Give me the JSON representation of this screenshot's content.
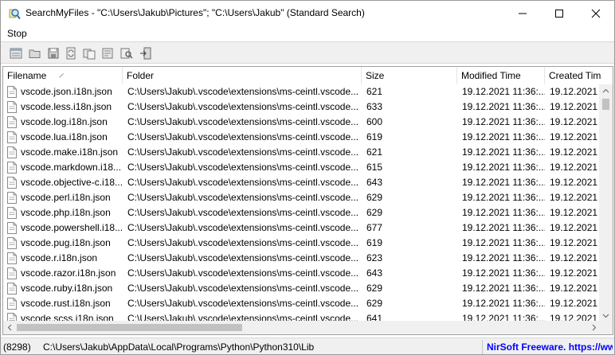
{
  "window": {
    "title": "SearchMyFiles - \"C:\\Users\\Jakub\\Pictures\"; \"C:\\Users\\Jakub\"  (Standard Search)"
  },
  "menu": {
    "stop_label": "Stop"
  },
  "toolbar": {
    "icons": [
      "new-search-icon",
      "open-icon",
      "save-icon",
      "refresh-icon",
      "copy-icon",
      "properties-icon",
      "find-icon",
      "exit-icon"
    ]
  },
  "columns": [
    {
      "label": "Filename"
    },
    {
      "label": "Folder"
    },
    {
      "label": "Size"
    },
    {
      "label": "Modified Time"
    },
    {
      "label": "Created Tim"
    }
  ],
  "rows": [
    [
      "vscode.json.i18n.json",
      "C:\\Users\\Jakub\\.vscode\\extensions\\ms-ceintl.vscode...",
      "621",
      "19.12.2021 11:36:...",
      "19.12.2021 1"
    ],
    [
      "vscode.less.i18n.json",
      "C:\\Users\\Jakub\\.vscode\\extensions\\ms-ceintl.vscode...",
      "633",
      "19.12.2021 11:36:...",
      "19.12.2021 1"
    ],
    [
      "vscode.log.i18n.json",
      "C:\\Users\\Jakub\\.vscode\\extensions\\ms-ceintl.vscode...",
      "600",
      "19.12.2021 11:36:...",
      "19.12.2021 1"
    ],
    [
      "vscode.lua.i18n.json",
      "C:\\Users\\Jakub\\.vscode\\extensions\\ms-ceintl.vscode...",
      "619",
      "19.12.2021 11:36:...",
      "19.12.2021 1"
    ],
    [
      "vscode.make.i18n.json",
      "C:\\Users\\Jakub\\.vscode\\extensions\\ms-ceintl.vscode...",
      "621",
      "19.12.2021 11:36:...",
      "19.12.2021 1"
    ],
    [
      "vscode.markdown.i18...",
      "C:\\Users\\Jakub\\.vscode\\extensions\\ms-ceintl.vscode...",
      "615",
      "19.12.2021 11:36:...",
      "19.12.2021 1"
    ],
    [
      "vscode.objective-c.i18...",
      "C:\\Users\\Jakub\\.vscode\\extensions\\ms-ceintl.vscode...",
      "643",
      "19.12.2021 11:36:...",
      "19.12.2021 1"
    ],
    [
      "vscode.perl.i18n.json",
      "C:\\Users\\Jakub\\.vscode\\extensions\\ms-ceintl.vscode...",
      "629",
      "19.12.2021 11:36:...",
      "19.12.2021 1"
    ],
    [
      "vscode.php.i18n.json",
      "C:\\Users\\Jakub\\.vscode\\extensions\\ms-ceintl.vscode...",
      "629",
      "19.12.2021 11:36:...",
      "19.12.2021 1"
    ],
    [
      "vscode.powershell.i18...",
      "C:\\Users\\Jakub\\.vscode\\extensions\\ms-ceintl.vscode...",
      "677",
      "19.12.2021 11:36:...",
      "19.12.2021 1"
    ],
    [
      "vscode.pug.i18n.json",
      "C:\\Users\\Jakub\\.vscode\\extensions\\ms-ceintl.vscode...",
      "619",
      "19.12.2021 11:36:...",
      "19.12.2021 1"
    ],
    [
      "vscode.r.i18n.json",
      "C:\\Users\\Jakub\\.vscode\\extensions\\ms-ceintl.vscode...",
      "623",
      "19.12.2021 11:36:...",
      "19.12.2021 1"
    ],
    [
      "vscode.razor.i18n.json",
      "C:\\Users\\Jakub\\.vscode\\extensions\\ms-ceintl.vscode...",
      "643",
      "19.12.2021 11:36:...",
      "19.12.2021 1"
    ],
    [
      "vscode.ruby.i18n.json",
      "C:\\Users\\Jakub\\.vscode\\extensions\\ms-ceintl.vscode...",
      "629",
      "19.12.2021 11:36:...",
      "19.12.2021 1"
    ],
    [
      "vscode.rust.i18n.json",
      "C:\\Users\\Jakub\\.vscode\\extensions\\ms-ceintl.vscode...",
      "629",
      "19.12.2021 11:36:...",
      "19.12.2021 1"
    ],
    [
      "vscode.scss.i18n.json",
      "C:\\Users\\Jakub\\.vscode\\extensions\\ms-ceintl.vscode...",
      "641",
      "19.12.2021 11:36:...",
      "19.12.2021 1"
    ]
  ],
  "status": {
    "count": "(8298)",
    "path": "C:\\Users\\Jakub\\AppData\\Local\\Programs\\Python\\Python310\\Lib",
    "link": "NirSoft Freeware. https://www.nirsoft.net"
  },
  "colors": {
    "link": "#0000ff",
    "toolbar_bg": "#f0f0f0"
  }
}
